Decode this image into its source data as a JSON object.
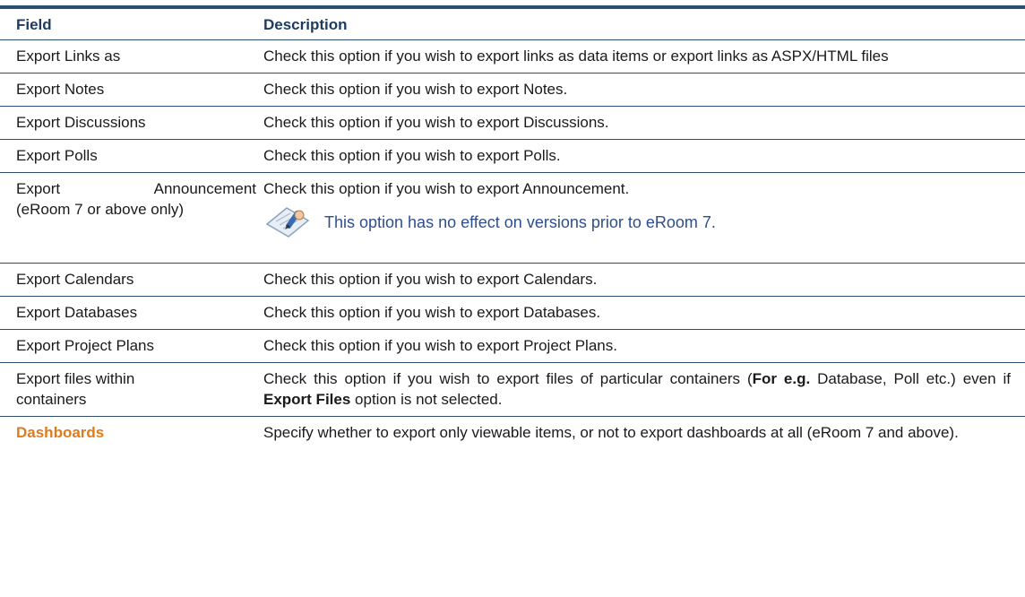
{
  "table": {
    "header": {
      "field": "Field",
      "description": "Description"
    },
    "rows": [
      {
        "field": "Export Links as",
        "description": "Check this option if you wish to export links as data items  or export links as ASPX/HTML files"
      },
      {
        "field": "Export Notes",
        "description": "Check this option if you wish to export Notes."
      },
      {
        "field": "Export Discussions",
        "description": "Check this option if you wish to export Discussions."
      },
      {
        "field": "Export Polls",
        "description": "Check this option if you wish to export Polls."
      },
      {
        "field_line1": "Export Announcement",
        "field_line2": "(eRoom 7 or above only)",
        "description": "Check this option if you wish to export Announcement.",
        "note": "This option has no effect on versions prior to eRoom 7.",
        "note_icon": "note-pencil-icon"
      },
      {
        "field": "Export Calendars",
        "description": "Check this option if you wish to export Calendars."
      },
      {
        "field": "Export Databases",
        "description": "Check this option if you wish to export Databases."
      },
      {
        "field": "Export Project Plans",
        "description": "Check this option if you wish to export Project Plans."
      },
      {
        "field": "Export files within containers",
        "desc_part1": "Check this option if you wish to export files of particular containers (",
        "desc_bold1": "For e.g.",
        "desc_part2": " Database, Poll etc.) even if ",
        "desc_bold2": "Export Files",
        "desc_part3": " option is not selected."
      },
      {
        "field": "Dashboards",
        "description": "Specify whether to export only viewable items, or not to export dashboards at all (eRoom 7 and above)."
      }
    ]
  },
  "colors": {
    "rule": "#2d4f6f",
    "header_text": "#1f3a5f",
    "highlight": "#e07b1a",
    "note_text": "#2d4f8f"
  }
}
